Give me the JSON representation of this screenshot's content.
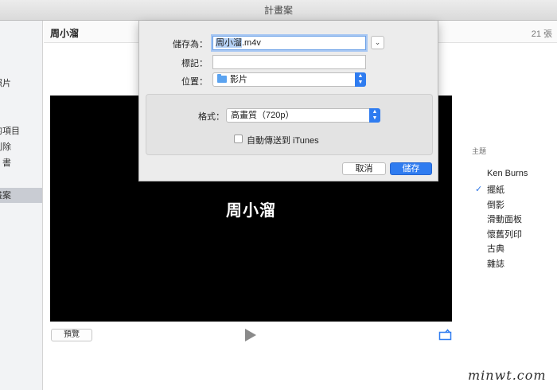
{
  "window": {
    "title": "計畫案"
  },
  "sidebar": {
    "items": [
      {
        "label": "照片"
      },
      {
        "label": "匯入的項目"
      },
      {
        "label": "刪除"
      },
      {
        "label": "書"
      },
      {
        "label": "計畫案"
      }
    ]
  },
  "header": {
    "project_title": "周小溜",
    "count": "21 張"
  },
  "preview": {
    "video_title": "周小溜",
    "preview_button": "預覽"
  },
  "themes": {
    "heading": "主題",
    "items": [
      "Ken Burns",
      "擺紙",
      "倒影",
      "滑動面板",
      "懷舊列印",
      "古典",
      "雜誌"
    ],
    "selected": "擺紙",
    "check_mark": "✓"
  },
  "save_dialog": {
    "save_as_label": "儲存為：",
    "filename_highlight": "周小溜",
    "filename_ext": ".m4v",
    "tags_label": "標記：",
    "tags_value": "",
    "location_label": "位置：",
    "location_value": "影片",
    "format_label": "格式：",
    "format_value": "高畫質（720p）",
    "itunes_label": "自動傳送到 iTunes",
    "itunes_checked": false,
    "cancel_label": "取消",
    "save_label": "儲存",
    "expand_glyph": "⌄"
  },
  "watermark": {
    "text": "minwt.com"
  },
  "colors": {
    "accent": "#2f7cf0",
    "check": "#2a74e6",
    "preview_bg": "#000000"
  }
}
